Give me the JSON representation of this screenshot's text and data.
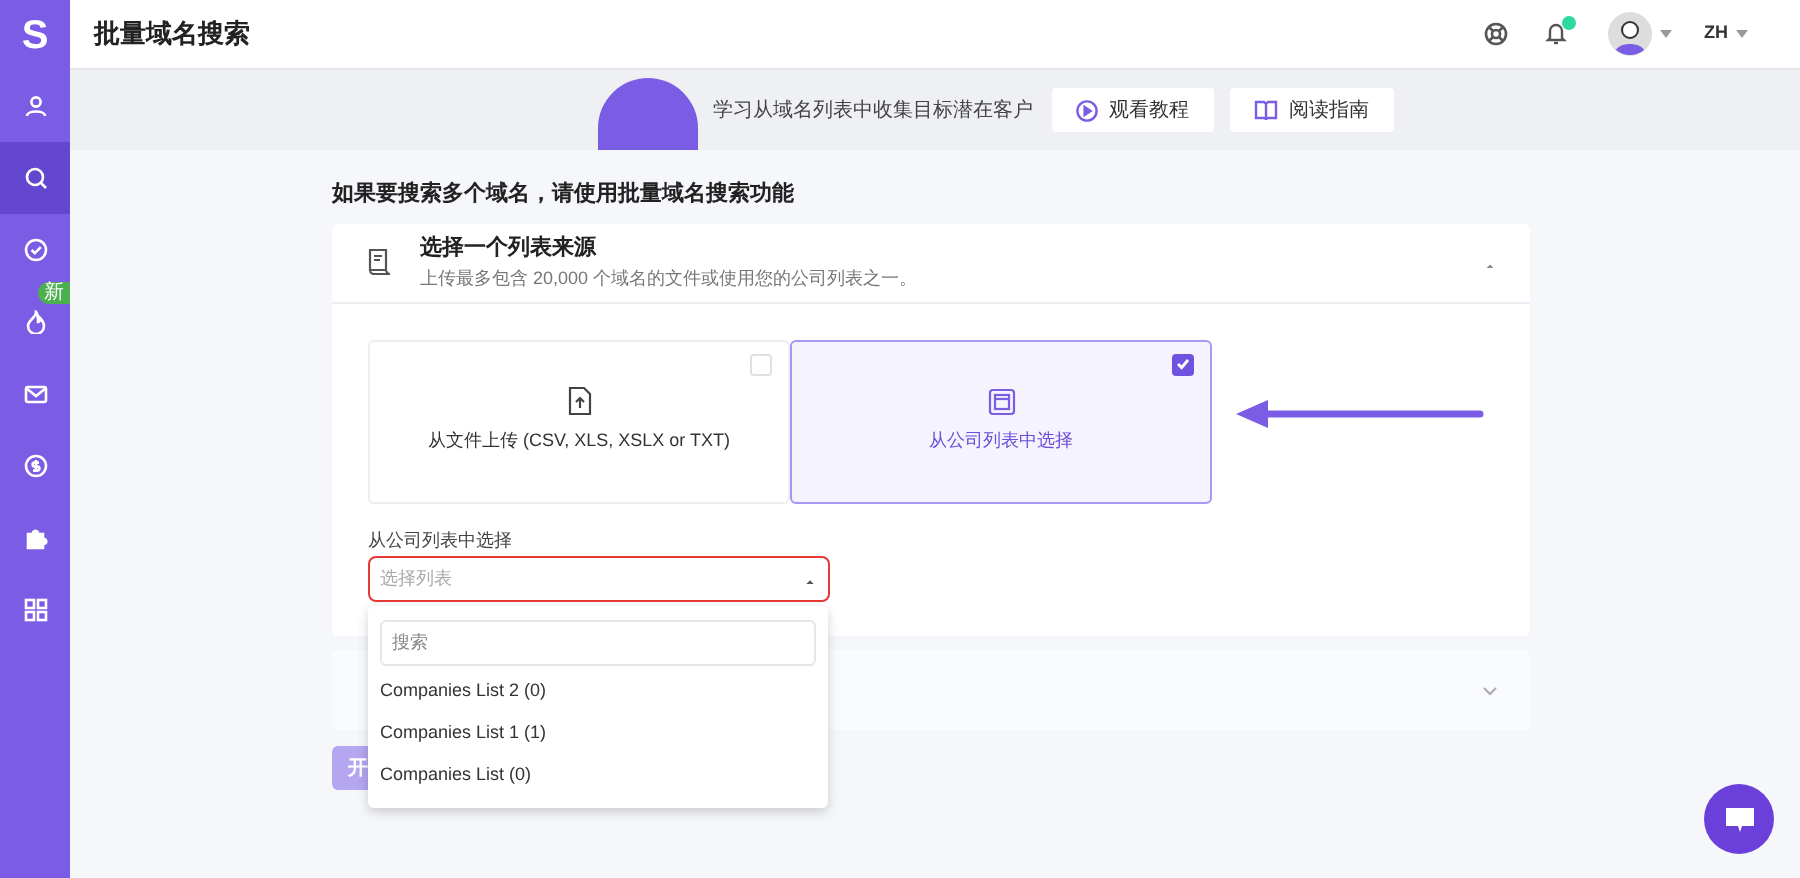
{
  "sidebar": {
    "logo": "S",
    "items": [
      {
        "selected": false
      },
      {
        "selected": true
      },
      {
        "selected": false
      },
      {
        "selected": false,
        "badge": "新"
      },
      {
        "selected": false
      },
      {
        "selected": false
      },
      {
        "selected": false
      },
      {
        "selected": false
      }
    ]
  },
  "header": {
    "title": "批量域名搜索",
    "has_notification": true,
    "language": "ZH"
  },
  "banner": {
    "text": "学习从域名列表中收集目标潜在客户",
    "buttons": [
      "观看教程",
      "阅读指南"
    ]
  },
  "heading": "如果要搜索多个域名，请使用批量域名搜索功能",
  "source_card": {
    "title": "选择一个列表来源",
    "subtitle": "上传最多包含 20,000 个域名的文件或使用您的公司列表之一。",
    "expanded": true,
    "options": [
      {
        "label": "从文件上传 (CSV, XLS, XSLX or TXT)",
        "selected": false
      },
      {
        "label": "从公司列表中选择",
        "selected": true
      }
    ],
    "select": {
      "label": "从公司列表中选择",
      "placeholder": "选择列表",
      "open": true
    },
    "dropdown": {
      "search_placeholder": "搜索",
      "items": [
        "Companies List 2 (0)",
        "Companies List 1 (1)",
        "Companies List (0)"
      ]
    }
  },
  "second_card": {
    "expanded": false
  },
  "submit_button": {
    "label": "开"
  }
}
